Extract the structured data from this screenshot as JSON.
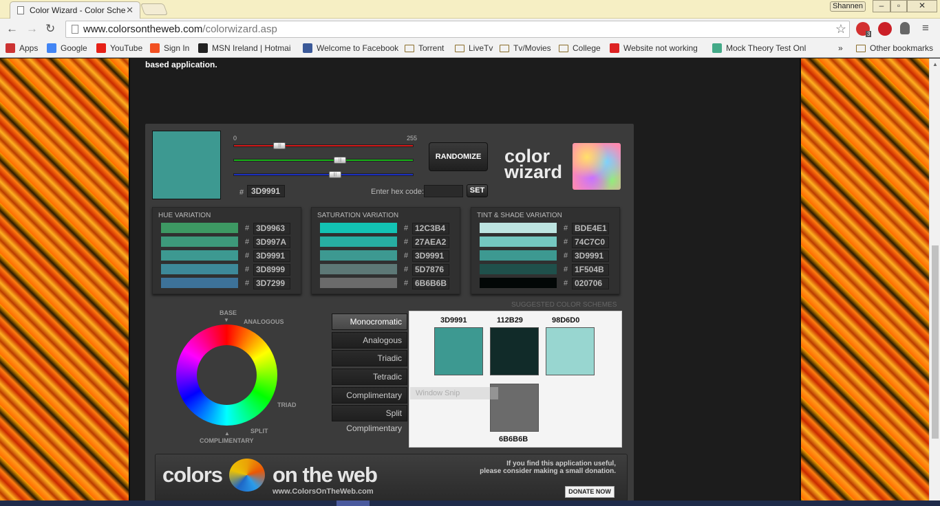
{
  "browser": {
    "tab_title": "Color Wizard - Color Sche",
    "user_name": "Shannen",
    "url_domain": "www.colorsontheweb.com",
    "url_path": "/colorwizard.asp",
    "ext_badge": "3"
  },
  "bookmarks": [
    {
      "label": "Apps",
      "icon": "apps-grid-icon"
    },
    {
      "label": "Google",
      "icon": "google-icon"
    },
    {
      "label": "YouTube",
      "icon": "youtube-icon"
    },
    {
      "label": "Sign In",
      "icon": "microsoft-icon"
    },
    {
      "label": "MSN Ireland | Hotmai",
      "icon": "msn-icon"
    },
    {
      "label": "Welcome to Facebook",
      "icon": "facebook-icon"
    },
    {
      "label": "Torrent",
      "icon": "folder-icon"
    },
    {
      "label": "LiveTv",
      "icon": "folder-icon"
    },
    {
      "label": "Tv/Movies",
      "icon": "folder-icon"
    },
    {
      "label": "College",
      "icon": "folder-icon"
    },
    {
      "label": "Website not working",
      "icon": "x-mark-icon"
    },
    {
      "label": "Mock Theory Test Onl",
      "icon": "triangle-icon"
    },
    {
      "label": "»",
      "icon": "chevron-more-icon"
    },
    {
      "label": "Other bookmarks",
      "icon": "folder-icon"
    }
  ],
  "page": {
    "intro_text": "based application."
  },
  "wizard": {
    "main_color": "#3D9991",
    "slider_min": "0",
    "slider_max": "255",
    "rgb": {
      "r": 61,
      "g": 153,
      "b": 145
    },
    "current_hash": "#",
    "current_hex": "3D9991",
    "randomize_label": "RANDOMIZE",
    "hex_label": "Enter hex code:",
    "hex_value": "",
    "set_label": "SET",
    "logo_line1": "color",
    "logo_line2": "wizard"
  },
  "variations": [
    {
      "title": "HUE VARIATION",
      "rows": [
        {
          "hex": "3D9963",
          "color": "#3D9963"
        },
        {
          "hex": "3D997A",
          "color": "#3D997A"
        },
        {
          "hex": "3D9991",
          "color": "#3D9991"
        },
        {
          "hex": "3D8999",
          "color": "#3D8999"
        },
        {
          "hex": "3D7299",
          "color": "#3D7299"
        }
      ]
    },
    {
      "title": "SATURATION VARIATION",
      "rows": [
        {
          "hex": "12C3B4",
          "color": "#12C3B4"
        },
        {
          "hex": "27AEA2",
          "color": "#27AEA2"
        },
        {
          "hex": "3D9991",
          "color": "#3D9991"
        },
        {
          "hex": "5D7876",
          "color": "#5D7876"
        },
        {
          "hex": "6B6B6B",
          "color": "#6B6B6B"
        }
      ]
    },
    {
      "title": "TINT & SHADE VARIATION",
      "rows": [
        {
          "hex": "BDE4E1",
          "color": "#BDE4E1"
        },
        {
          "hex": "74C7C0",
          "color": "#74C7C0"
        },
        {
          "hex": "3D9991",
          "color": "#3D9991"
        },
        {
          "hex": "1F504B",
          "color": "#1F504B"
        },
        {
          "hex": "020706",
          "color": "#020706"
        }
      ]
    }
  ],
  "suggested_label": "SUGGESTED COLOR SCHEMES",
  "wheel_labels": {
    "base": "BASE",
    "analogous": "ANALOGOUS",
    "triad": "TRIAD",
    "split": "SPLIT",
    "complimentary": "COMPLIMENTARY"
  },
  "schemes": [
    "Monocromatic",
    "Analogous",
    "Triadic",
    "Tetradic",
    "Complimentary",
    "Split Complimentary"
  ],
  "active_scheme": "Monocromatic",
  "scheme_colors": [
    {
      "hex": "3D9991",
      "color": "#3D9991"
    },
    {
      "hex": "112B29",
      "color": "#112B29"
    },
    {
      "hex": "98D6D0",
      "color": "#98D6D0"
    },
    {
      "hex": "6B6B6B",
      "color": "#6B6B6B"
    }
  ],
  "snip_overlay": "Window Snip",
  "banner": {
    "word_left": "colors",
    "word_right": "on the web",
    "url": "www.ColorsOnTheWeb.com",
    "donate_line1": "If you find this application useful,",
    "donate_line2": "please consider making a small donation.",
    "donate_button": "DONATE NOW"
  }
}
